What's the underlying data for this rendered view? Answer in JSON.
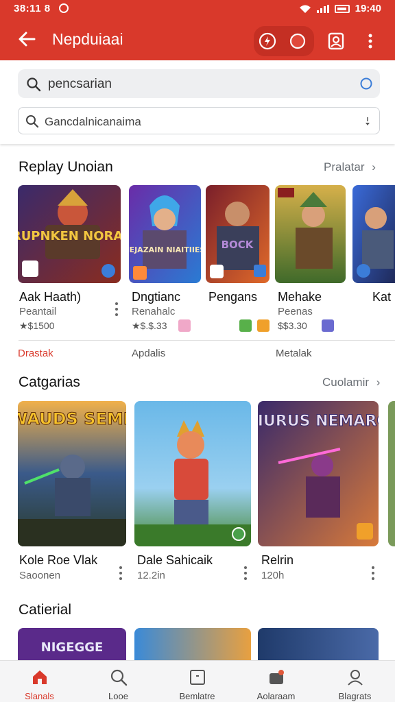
{
  "status_bar": {
    "time": "38:11 8",
    "right_time": "19:40"
  },
  "app_bar": {
    "title": "Nepduiaai"
  },
  "search": {
    "primary_value": "pencsarian",
    "secondary_value": "Gancdalnicanaima"
  },
  "section_replay": {
    "title": "Replay Unoian",
    "link": "Pralatar",
    "games": [
      {
        "name": "Aak Haath)",
        "sub": "Peantail",
        "price": "★$1500",
        "art_title": "ERUPNKEN NORALI"
      },
      {
        "name": "Dngtianc",
        "sub": "Renahalc",
        "price": "★$.$.33",
        "art_title": "SEJAZAIN NIAITIIES"
      },
      {
        "name": "Pengans",
        "sub": "",
        "price": "",
        "art_title": "BOCK"
      },
      {
        "name": "Mehake",
        "sub": "Peenas",
        "price": "$$3.30",
        "art_title": ""
      },
      {
        "name": "Kat",
        "sub": "",
        "price": "",
        "art_title": ""
      }
    ],
    "tags": [
      "Drastak",
      "Apdalis",
      "Metalak"
    ]
  },
  "section_categories": {
    "title": "Catgarias",
    "link": "Cuolamir",
    "games": [
      {
        "name": "Kole Roe Vlak",
        "sub": "Saoonen",
        "art_title": "WAUDS SEME"
      },
      {
        "name": "Dale Sahicaik",
        "sub": "12.2in",
        "art_title": ""
      },
      {
        "name": "Relrin",
        "sub": "120h",
        "art_title": "SIURUS NEMARO"
      }
    ]
  },
  "section_third": {
    "title": "Catierial",
    "art_titles": [
      "NIGEGGE"
    ]
  },
  "bottom_nav": [
    {
      "label": "Slanals",
      "icon": "home-icon",
      "active": true
    },
    {
      "label": "Looe",
      "icon": "search-icon",
      "active": false
    },
    {
      "label": "Bemlatre",
      "icon": "library-icon",
      "active": false
    },
    {
      "label": "Aolaraam",
      "icon": "apps-icon",
      "active": false
    },
    {
      "label": "Blagrats",
      "icon": "profile-icon",
      "active": false
    }
  ],
  "colors": {
    "accent": "#d9392b",
    "accent_dark": "#c42f23",
    "link_red": "#d9392b"
  }
}
